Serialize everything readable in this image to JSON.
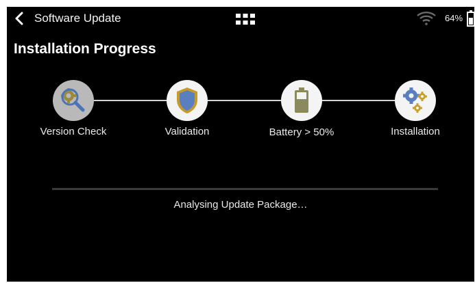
{
  "header": {
    "back_icon": "chevron-left-icon",
    "title": "Software Update",
    "grid_icon": "grid-menu-icon",
    "wifi_icon": "wifi-icon",
    "battery_percent": "64%",
    "battery_icon": "battery-icon"
  },
  "page_title": "Installation Progress",
  "steps": [
    {
      "label": "Version Check",
      "icon": "magnifier-gear-icon",
      "state": "active"
    },
    {
      "label": "Validation",
      "icon": "shield-icon",
      "state": "pending"
    },
    {
      "label": "Battery > 50%",
      "icon": "battery-level-icon",
      "state": "pending"
    },
    {
      "label": "Installation",
      "icon": "gears-icon",
      "state": "pending"
    }
  ],
  "status": "Analysing Update Package…",
  "progress": 0,
  "colors": {
    "background": "#000000",
    "shield_fill": "#5a7fbf",
    "shield_border": "#c89a2b",
    "battery_fill": "#8a8a5c",
    "gear_gold": "#c8a12b",
    "gear_blue": "#5a7fbf"
  }
}
